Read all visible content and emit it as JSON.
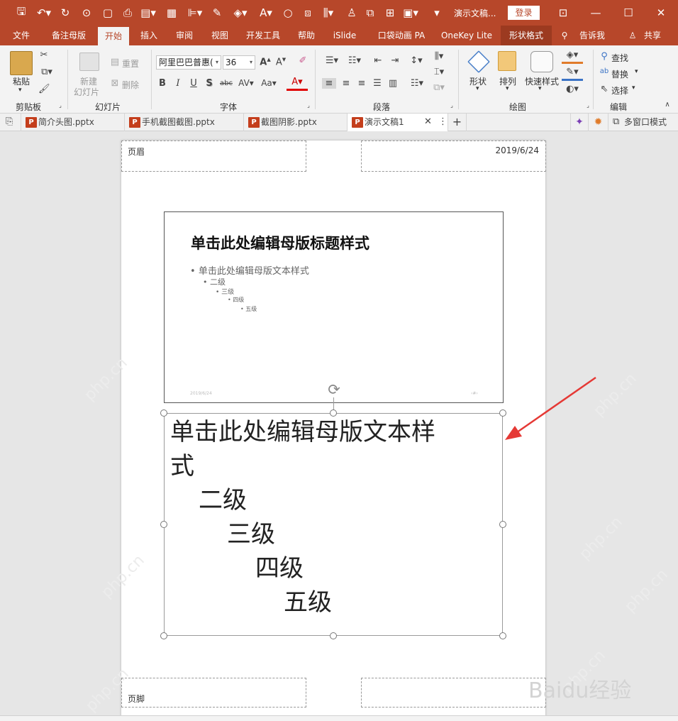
{
  "titlebar": {
    "doc_title": "演示文稿...",
    "login_label": "登录",
    "quick_access": [
      "save-icon",
      "undo-icon",
      "redo-icon",
      "preview-icon",
      "new-icon",
      "print-preview-icon",
      "slideshow-icon",
      "layout-icon",
      "align-icon",
      "pen-icon",
      "fill-icon",
      "font-color-icon",
      "circle-icon",
      "shape-icon",
      "chart-icon",
      "person-icon",
      "format-icon",
      "group-icon",
      "table-icon",
      "picture-icon",
      "more-icon"
    ]
  },
  "tabs": [
    "文件",
    "备注母版",
    "开始",
    "插入",
    "审阅",
    "视图",
    "开发工具",
    "帮助",
    "iSlide",
    "口袋动画 PA",
    "OneKey Lite",
    "形状格式",
    "告诉我",
    "共享"
  ],
  "ribbon": {
    "clipboard": {
      "label": "剪贴板",
      "paste": "粘贴"
    },
    "slides": {
      "label": "幻灯片",
      "new_slide_1": "新建",
      "new_slide_2": "幻灯片",
      "reset": "重置",
      "delete": "删除"
    },
    "font": {
      "label": "字体",
      "font_name": "阿里巴巴普惠(",
      "font_size": "36"
    },
    "paragraph": {
      "label": "段落"
    },
    "drawing": {
      "label": "绘图",
      "shapes": "形状",
      "arrange": "排列",
      "quick_styles": "快速样式"
    },
    "editing": {
      "label": "编辑",
      "find": "查找",
      "replace": "替换",
      "select": "选择"
    }
  },
  "doc_tabs": [
    {
      "label": "简介头图.pptx"
    },
    {
      "label": "手机截图截图.pptx"
    },
    {
      "label": "截图阴影.pptx"
    },
    {
      "label": "演示文稿1"
    }
  ],
  "doc_tabs_right": {
    "multi_window": "多窗口模式"
  },
  "page": {
    "header": "页眉",
    "date": "2019/6/24",
    "footer": "页脚",
    "slide_title": "单击此处编辑母版标题样式",
    "slide_levels": [
      "单击此处编辑母版文本样式",
      "二级",
      "三级",
      "四级",
      "五级"
    ],
    "slide_footer_date": "2019/6/24",
    "slide_page_num": "‹#›",
    "notes_lines": [
      "单击此处编辑母版文本样",
      "式",
      "二级",
      "三级",
      "四级",
      "五级"
    ]
  },
  "watermark": {
    "site": "php.cn",
    "baidu": "Baidu经验"
  },
  "colors": {
    "accent": "#b7472a",
    "arrow": "#e53935"
  }
}
